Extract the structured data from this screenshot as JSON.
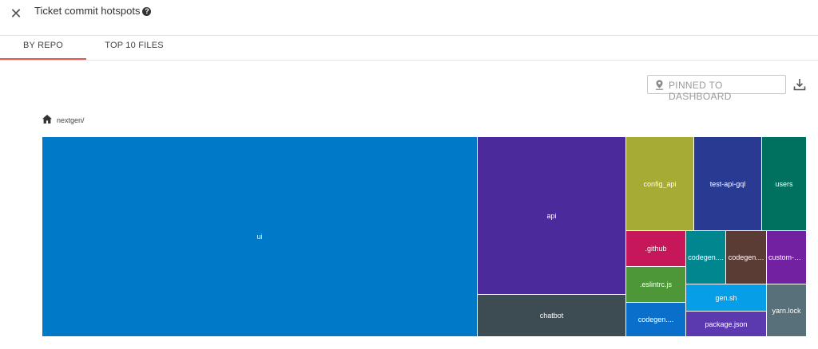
{
  "header": {
    "close_icon": "close-icon",
    "title": "Ticket commit hotspots",
    "help_icon": "help-circle-icon",
    "help_glyph": "?"
  },
  "tabs": [
    {
      "label": "BY REPO",
      "active": true
    },
    {
      "label": "TOP 10 FILES",
      "active": false
    }
  ],
  "toolbar": {
    "pin_icon": "location-pin-icon",
    "pin_label": "PINNED TO DASHBOARD",
    "download_icon": "download-icon"
  },
  "breadcrumb": {
    "home_icon": "home-icon",
    "path": "nextgen/"
  },
  "colors": {
    "accent": "#e8554e"
  },
  "treemap": [
    {
      "label": "ui",
      "color": "#0079c9"
    },
    {
      "label": "api",
      "color": "#4b2b9c"
    },
    {
      "label": "chatbot",
      "color": "#3d4b52"
    },
    {
      "label": "config_api",
      "color": "#a5ab35"
    },
    {
      "label": "test-api-gql",
      "color": "#283a91"
    },
    {
      "label": "users",
      "color": "#00715f"
    },
    {
      "label": ".github",
      "color": "#c5175a"
    },
    {
      "label": "codegen....",
      "color": "#00868f"
    },
    {
      "label": "codegen....",
      "color": "#5b3c34"
    },
    {
      "label": "custom-co...",
      "color": "#7221a0"
    },
    {
      "label": ".eslintrc.js",
      "color": "#4d9739"
    },
    {
      "label": "gen.sh",
      "color": "#069ee6"
    },
    {
      "label": "yarn.lock",
      "color": "#577079"
    },
    {
      "label": "codegen....",
      "color": "#0a6fca"
    },
    {
      "label": "package.json",
      "color": "#5b3aaf"
    }
  ]
}
